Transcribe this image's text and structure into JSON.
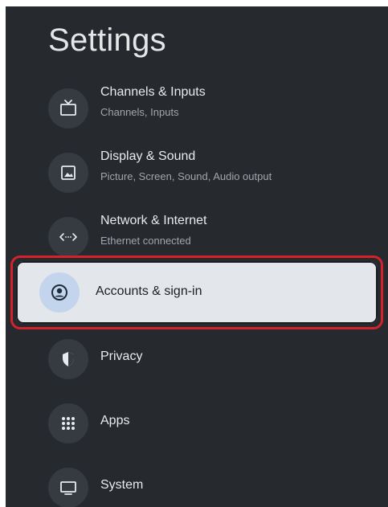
{
  "page": {
    "title": "Settings"
  },
  "menu": {
    "items": [
      {
        "label": "Channels & Inputs",
        "subtitle": "Channels, Inputs",
        "icon": "tv-icon"
      },
      {
        "label": "Display & Sound",
        "subtitle": "Picture, Screen, Sound, Audio output",
        "icon": "picture-icon"
      },
      {
        "label": "Network & Internet",
        "subtitle": "Ethernet connected",
        "icon": "network-icon"
      },
      {
        "label": "Accounts & sign-in",
        "subtitle": "",
        "icon": "account-icon",
        "focused": true
      },
      {
        "label": "Privacy",
        "subtitle": "",
        "icon": "shield-icon"
      },
      {
        "label": "Apps",
        "subtitle": "",
        "icon": "apps-grid-icon"
      },
      {
        "label": "System",
        "subtitle": "",
        "icon": "monitor-icon"
      }
    ]
  },
  "colors": {
    "background": "#262a2f",
    "focus_card": "#e3e6ea",
    "focus_ring": "#d3222b",
    "icon_circle": "#363b41",
    "focused_icon_circle": "#c3d5ec"
  }
}
